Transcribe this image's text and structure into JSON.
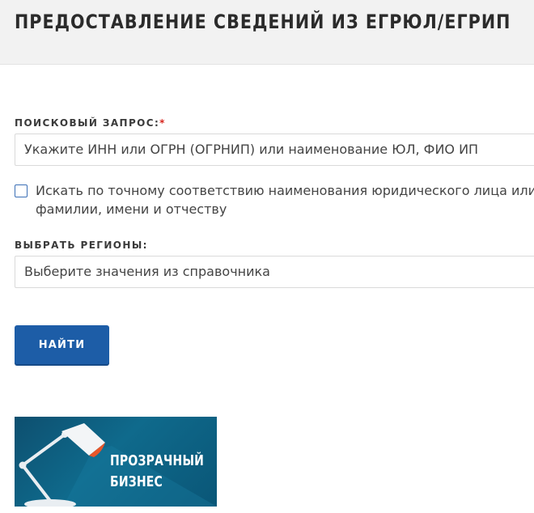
{
  "header": {
    "title": "ПРЕДОСТАВЛЕНИЕ СВЕДЕНИЙ ИЗ ЕГРЮЛ/ЕГРИП"
  },
  "form": {
    "query_label": "ПОИСКОВЫЙ ЗАПРОС:",
    "required_mark": "*",
    "query_placeholder": "Укажите ИНН или ОГРН (ОГРНИП) или наименование ЮЛ, ФИО ИП",
    "exact_match_checked": false,
    "exact_match_label": "Искать по точному соответствию наименования юридического лица или фамилии, имени и отчеству",
    "regions_label": "ВЫБРАТЬ РЕГИОНЫ:",
    "regions_placeholder": "Выберите значения из справочника",
    "search_button": "НАЙТИ"
  },
  "banner": {
    "line1": "ПРОЗРАЧНЫЙ",
    "line2": "БИЗНЕС",
    "icon": "desk-lamp-icon"
  },
  "colors": {
    "header_bg": "#f2f2f2",
    "button_bg": "#1d5da7",
    "required": "#d7261e",
    "banner_bg": "#0f6a8c",
    "lamp_accent": "#e8562a"
  }
}
